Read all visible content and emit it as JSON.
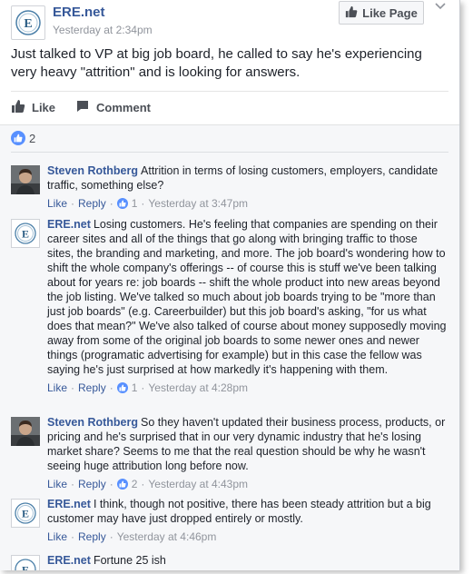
{
  "post": {
    "page_name": "ERE.net",
    "time": "Yesterday at 2:34pm",
    "like_page_label": "Like Page",
    "text": "Just talked to VP at big job board, he called to say he's experiencing very heavy \"attrition\" and is looking for answers."
  },
  "actions": {
    "like": "Like",
    "comment": "Comment"
  },
  "reactions": {
    "count": "2"
  },
  "comments": [
    {
      "author": "Steven Rothberg",
      "text": "Attrition in terms of losing customers, employers, candidate traffic, something else?",
      "like": "Like",
      "reply": "Reply",
      "likes": "1",
      "time": "Yesterday at 3:47pm"
    },
    {
      "author": "ERE.net",
      "text": "Losing customers. He's feeling that companies are spending on their career sites and all of the things that go along with bringing traffic to those sites, the branding and marketing, and more. The job board's wondering how to shift the whole company's offerings -- of course this is stuff we've been talking about for years re: job boards -- shift the whole product into new areas beyond the job listing. We've talked so much about job boards trying to be \"more than just job boards\" (e.g. Careerbuilder) but this job board's asking, \"for us what does that mean?\" We've also talked of course about money supposedly moving away from some of the original job boards to some newer ones and newer things (programatic advertising for example) but in this case the fellow was saying he's just surprised at how markedly it's happening with them.",
      "like": "Like",
      "reply": "Reply",
      "likes": "1",
      "time": "Yesterday at 4:28pm"
    },
    {
      "author": "Steven Rothberg",
      "text": "So they haven't updated their business process, products, or pricing and he's surprised that in our very dynamic industry that he's losing market share? Seems to me that the real question should be why he wasn't seeing huge attribution long before now.",
      "like": "Like",
      "reply": "Reply",
      "likes": "2",
      "time": "Yesterday at 4:43pm"
    },
    {
      "author": "ERE.net",
      "text": "I think, though not positive, there has been steady attrition but a big customer may have just dropped entirely or mostly.",
      "like": "Like",
      "reply": "Reply",
      "likes": "",
      "time": "Yesterday at 4:46pm"
    },
    {
      "author": "ERE.net",
      "text": "Fortune 25 ish"
    }
  ],
  "colors": {
    "link": "#365899",
    "meta": "#90949c",
    "like_blue": "#5890ff",
    "comments_bg": "#f6f7f9"
  }
}
